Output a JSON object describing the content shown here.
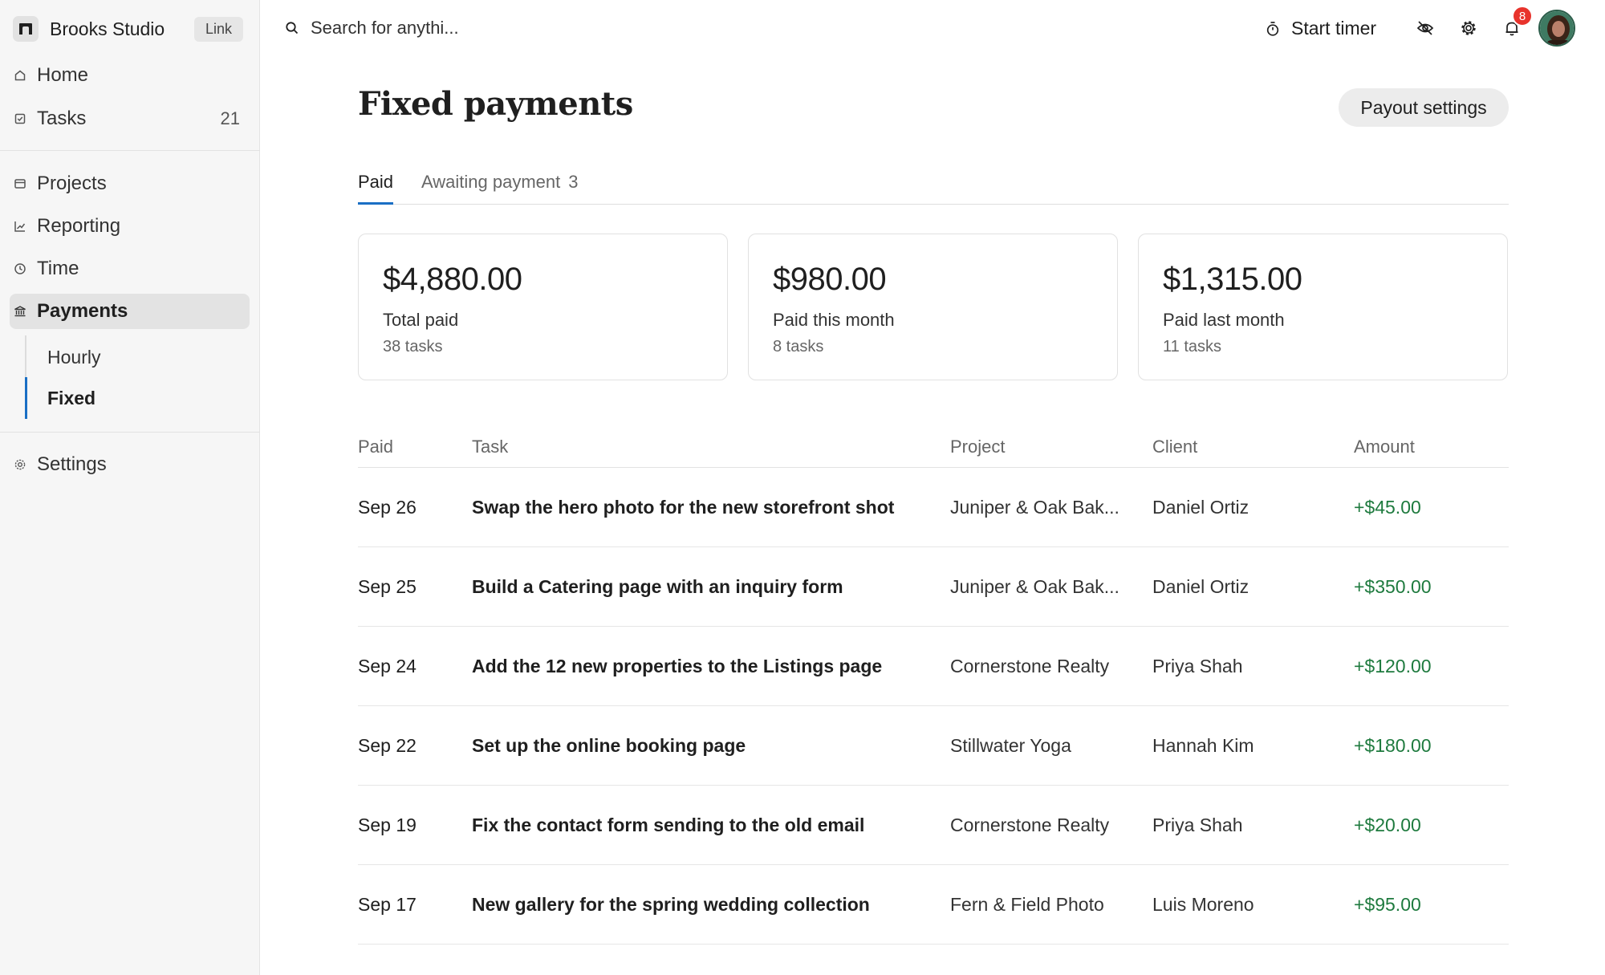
{
  "sidebar": {
    "workspace": {
      "name": "Brooks Studio",
      "link_label": "Link"
    },
    "nav": {
      "home": "Home",
      "tasks": "Tasks",
      "tasks_count": "21",
      "projects": "Projects",
      "reporting": "Reporting",
      "time": "Time",
      "payments": "Payments",
      "settings": "Settings"
    },
    "payments_sub": {
      "hourly": "Hourly",
      "fixed": "Fixed"
    }
  },
  "topbar": {
    "search_placeholder": "Search for anythi...",
    "start_timer": "Start timer",
    "notifications_count": "8"
  },
  "main": {
    "title": "Fixed payments",
    "payout_button": "Payout settings",
    "tabs": {
      "paid": "Paid",
      "awaiting": "Awaiting payment",
      "awaiting_count": "3"
    },
    "cards": [
      {
        "amount": "$4,880.00",
        "label": "Total paid",
        "sub": "38 tasks"
      },
      {
        "amount": "$980.00",
        "label": "Paid this month",
        "sub": "8 tasks"
      },
      {
        "amount": "$1,315.00",
        "label": "Paid last month",
        "sub": "11 tasks"
      }
    ],
    "table": {
      "headers": {
        "paid": "Paid",
        "task": "Task",
        "project": "Project",
        "client": "Client",
        "amount": "Amount"
      },
      "rows": [
        {
          "date": "Sep 26",
          "task": "Swap the hero photo for the new storefront shot",
          "project": "Juniper & Oak Bak...",
          "client": "Daniel Ortiz",
          "amount": "+$45.00"
        },
        {
          "date": "Sep 25",
          "task": "Build a Catering page with an inquiry form",
          "project": "Juniper & Oak Bak...",
          "client": "Daniel Ortiz",
          "amount": "+$350.00"
        },
        {
          "date": "Sep 24",
          "task": "Add the 12 new properties to the Listings page",
          "project": "Cornerstone Realty",
          "client": "Priya Shah",
          "amount": "+$120.00"
        },
        {
          "date": "Sep 22",
          "task": "Set up the online booking page",
          "project": "Stillwater Yoga",
          "client": "Hannah Kim",
          "amount": "+$180.00"
        },
        {
          "date": "Sep 19",
          "task": "Fix the contact form sending to the old email",
          "project": "Cornerstone Realty",
          "client": "Priya Shah",
          "amount": "+$20.00"
        },
        {
          "date": "Sep 17",
          "task": "New gallery for the spring wedding collection",
          "project": "Fern & Field Photo",
          "client": "Luis Moreno",
          "amount": "+$95.00"
        }
      ]
    }
  },
  "colors": {
    "accent": "#1a6fc4",
    "positive": "#1e7a3e",
    "badge": "#e8332c"
  }
}
